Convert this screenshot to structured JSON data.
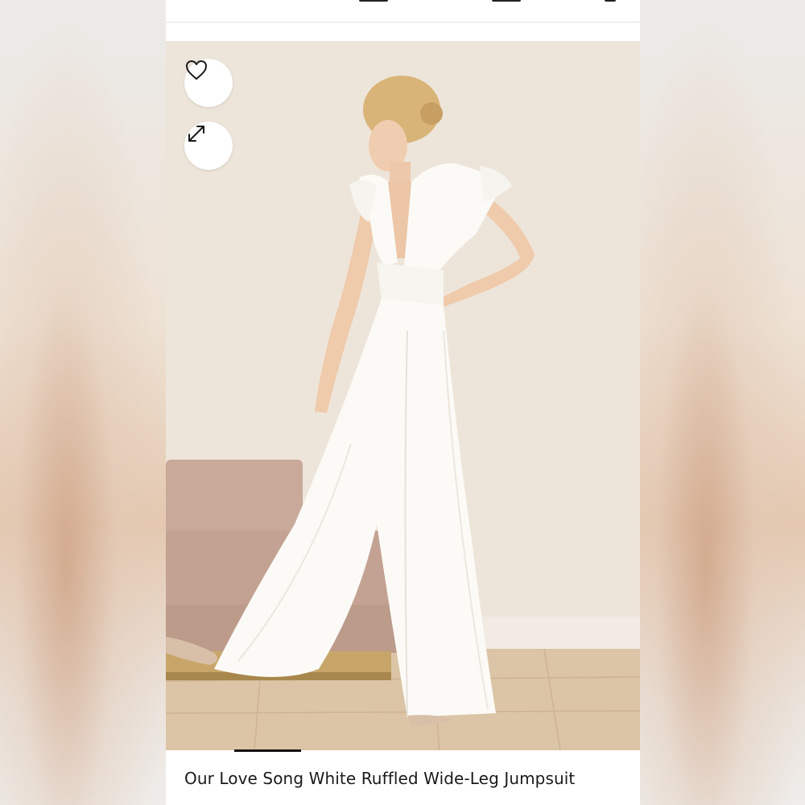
{
  "product": {
    "title": "Our Love Song White Ruffled Wide-Leg Jumpsuit"
  },
  "actions": {
    "favorite_icon": "heart-outline-icon",
    "expand_icon": "expand-arrows-icon"
  },
  "gallery": {
    "current_index": 1
  },
  "colors": {
    "background": "#ffffff",
    "text": "#1a1a1a",
    "pager_active": "#111111"
  }
}
